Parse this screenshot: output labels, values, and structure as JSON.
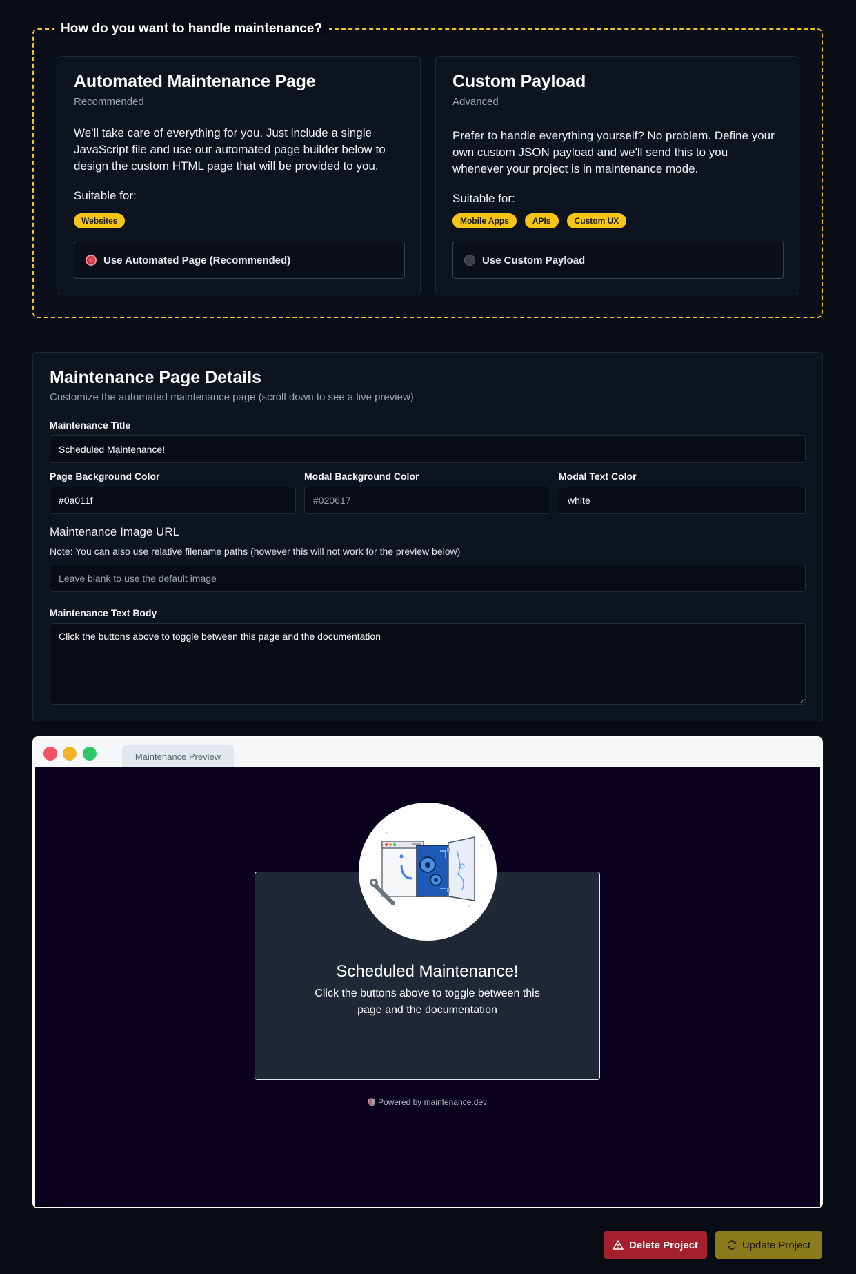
{
  "mode": {
    "legend": "How do you want to handle maintenance?",
    "automated": {
      "title": "Automated Maintenance Page",
      "subtitle": "Recommended",
      "description": "We'll take care of everything for you. Just include a single JavaScript file and use our automated page builder below to design the custom HTML page that will be provided to you.",
      "suitable_label": "Suitable for:",
      "tags": [
        "Websites"
      ],
      "radio_label": "Use Automated Page (Recommended)",
      "selected": true
    },
    "custom": {
      "title": "Custom Payload",
      "subtitle": "Advanced",
      "description": "Prefer to handle everything yourself? No problem. Define your own custom JSON payload and we'll send this to you whenever your project is in maintenance mode.",
      "suitable_label": "Suitable for:",
      "tags": [
        "Mobile Apps",
        "APIs",
        "Custom UX"
      ],
      "radio_label": "Use Custom Payload",
      "selected": false
    }
  },
  "details": {
    "title": "Maintenance Page Details",
    "subtitle": "Customize the automated maintenance page (scroll down to see a live preview)",
    "maintenance_title_label": "Maintenance Title",
    "maintenance_title_value": "Scheduled Maintenance!",
    "page_bg_label": "Page Background Color",
    "page_bg_value": "#0a011f",
    "modal_bg_label": "Modal Background Color",
    "modal_bg_value": "#020617",
    "modal_text_label": "Modal Text Color",
    "modal_text_value": "white",
    "image_url_label": "Maintenance Image URL",
    "image_url_note": "Note: You can also use relative filename paths (however this will not work for the preview below)",
    "image_url_placeholder": "Leave blank to use the default image",
    "body_label": "Maintenance Text Body",
    "body_value": "Click the buttons above to toggle between this page and the documentation"
  },
  "preview": {
    "tab_label": "Maintenance Preview",
    "modal_title": "Scheduled Maintenance!",
    "modal_body": "Click the buttons above to toggle between this page and the documentation",
    "powered_prefix": "Powered by",
    "powered_link": "maintenance.dev"
  },
  "actions": {
    "delete_label": "Delete Project",
    "update_label": "Update Project"
  },
  "colors": {
    "accent_yellow": "#f5c518",
    "danger_red": "#a3202c",
    "preview_bg": "#0a011f"
  }
}
